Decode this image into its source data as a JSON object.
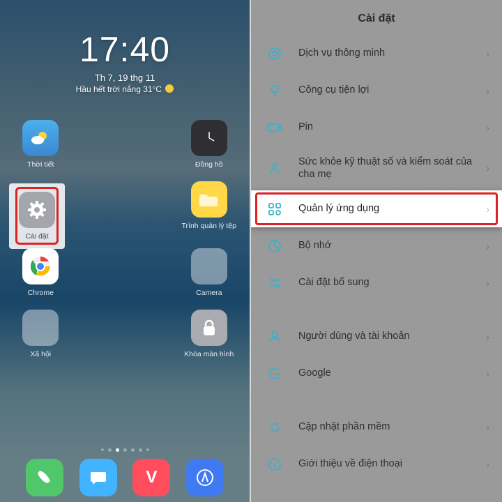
{
  "left": {
    "clock": "17:40",
    "date": "Th 7, 19 thg 11",
    "weather": "Hầu hết trời nắng 31°C",
    "apps": {
      "weather": "Thời tiết",
      "clock": "Đồng hồ",
      "settings": "Cài đặt",
      "files": "Trình quản lý tệp",
      "chrome": "Chrome",
      "camera": "Camera",
      "social": "Xã hội",
      "lockscreen": "Khóa màn hình"
    }
  },
  "right": {
    "title": "Cài đặt",
    "items": {
      "smart": "Dịch vụ thông minh",
      "tools": "Công cụ tiện lợi",
      "battery": "Pin",
      "digital": "Sức khỏe kỹ thuật số và kiểm soát của cha mẹ",
      "apps": "Quản lý ứng dụng",
      "storage": "Bộ nhớ",
      "additional": "Cài đặt bổ sung",
      "users": "Người dùng và tài khoản",
      "google": "Google",
      "update": "Cập nhật phần mềm",
      "about": "Giới thiệu về điện thoại"
    }
  }
}
